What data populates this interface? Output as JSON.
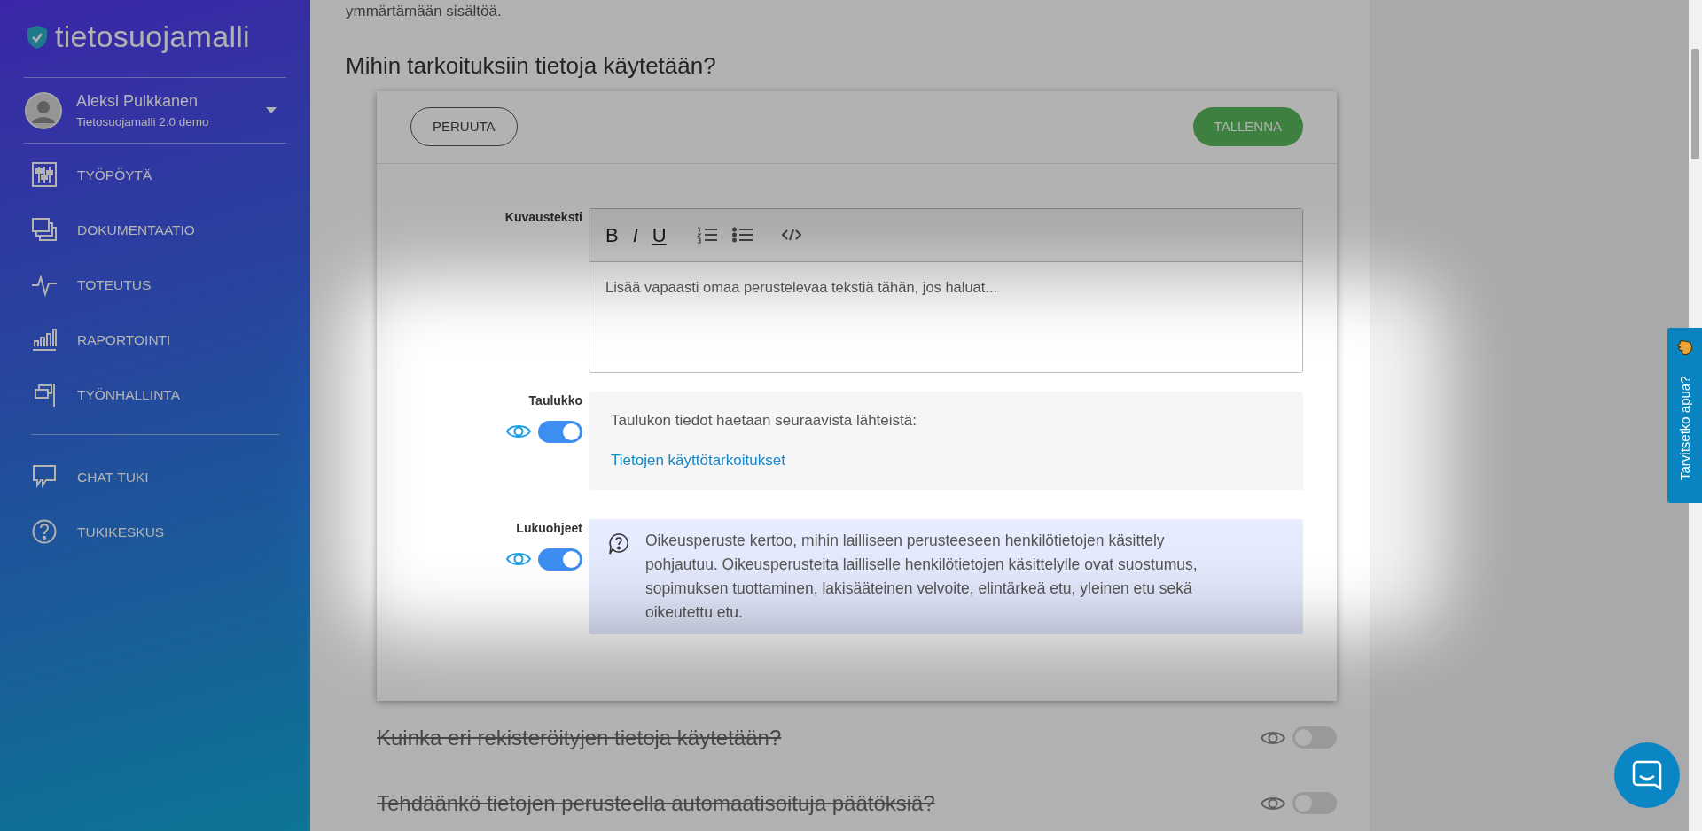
{
  "sidebar": {
    "logo": "tietosuojamalli",
    "user": {
      "name": "Aleksi Pulkkanen",
      "org": "Tietosuojamalli 2.0 demo"
    },
    "nav": [
      {
        "label": "TYÖPÖYTÄ"
      },
      {
        "label": "DOKUMENTAATIO"
      },
      {
        "label": "TOTEUTUS"
      },
      {
        "label": "RAPORTOINTI"
      },
      {
        "label": "TYÖNHALLINTA"
      }
    ],
    "support": [
      {
        "label": "CHAT-TUKI"
      },
      {
        "label": "TUKIKESKUS"
      }
    ]
  },
  "intro_text": "ymmärtämään sisältöä.",
  "section": {
    "title": "Mihin tarkoituksiin tietoja käytetään?",
    "cancel": "PERUUTA",
    "save": "TALLENNA",
    "fields": [
      {
        "kind": "editor",
        "label": "Kuvausteksti",
        "toolbar": [
          "B",
          "I",
          "U"
        ],
        "placeholder": "Lisää vapaasti omaa perustelevaa tekstiä tähän, jos haluat..."
      },
      {
        "kind": "table",
        "label": "Taulukko",
        "on": true,
        "text": "Taulukon tiedot haetaan seuraavista lähteistä:",
        "link": "Tietojen käyttötarkoitukset"
      },
      {
        "kind": "note",
        "label": "Lukuohjeet",
        "on": true,
        "text": "Oikeusperuste kertoo, mihin lailliseen perusteeseen henkilötietojen käsittely pohjautuu. Oikeusperusteita lailliselle henkilötietojen käsittelylle ovat suostumus, sopimuksen tuottaminen, lakisääteinen velvoite, elintärkeä etu, yleinen etu sekä oikeutettu etu."
      }
    ]
  },
  "other_sections": [
    {
      "title": "Kuinka eri rekisteröityjen tietoja käytetään?",
      "on": false
    },
    {
      "title": "Tehdäänkö tietojen perusteella automaatisoituja päätöksiä?",
      "on": false
    }
  ],
  "help_tab": "Tarvitsetko apua?"
}
